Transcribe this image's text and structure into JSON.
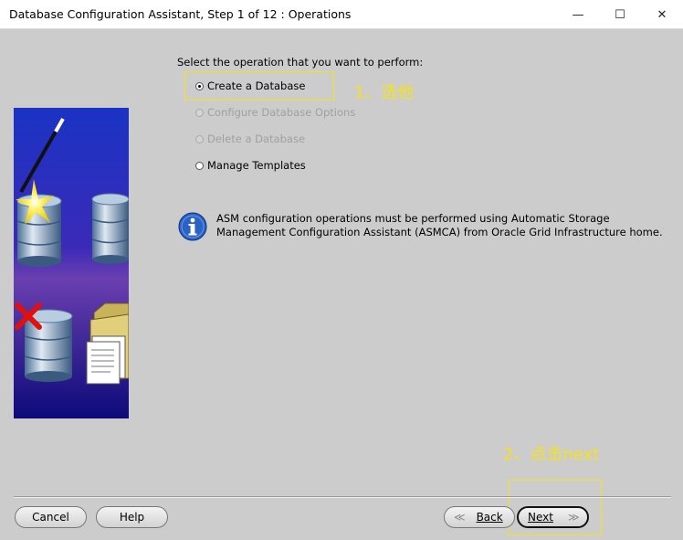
{
  "window": {
    "title": "Database Configuration Assistant, Step 1 of 12 : Operations",
    "controls": {
      "minimize": "—",
      "maximize": "☐",
      "close": "✕"
    }
  },
  "main": {
    "prompt": "Select the operation that you want to perform:",
    "options": [
      {
        "label": "Create a Database",
        "selected": true,
        "enabled": true
      },
      {
        "label": "Configure Database Options",
        "selected": false,
        "enabled": false
      },
      {
        "label": "Delete a Database",
        "selected": false,
        "enabled": false
      },
      {
        "label": "Manage Templates",
        "selected": false,
        "enabled": true
      }
    ],
    "info": {
      "icon": "info-icon",
      "text": "ASM configuration operations must be performed using Automatic Storage Management Configuration Assistant (ASMCA) from Oracle Grid Infrastructure home."
    }
  },
  "annotations": {
    "step1": "1、选他",
    "step2": "2、点击next",
    "color": "#f4e21a"
  },
  "buttons": {
    "cancel": "Cancel",
    "help": "Help",
    "back": "Back",
    "next": "Next"
  },
  "colors": {
    "background": "#cccccc",
    "art_top": "#1a33c4",
    "art_bottom": "#0d0a7a"
  }
}
